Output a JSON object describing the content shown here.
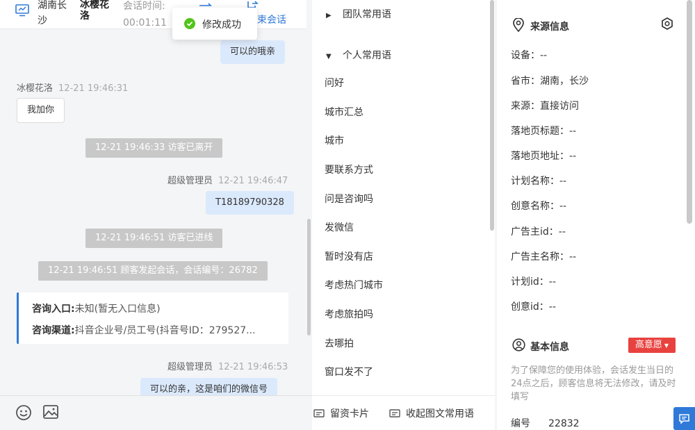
{
  "header": {
    "location": "湖南长沙",
    "visitor_name": "冰樱花洛",
    "session_time_label": "会话时间:",
    "session_time": "00:01:11",
    "end_session": "结束会话",
    "end_session_visible": "束会话"
  },
  "toast": {
    "text": "修改成功"
  },
  "messages": [
    {
      "type": "agent_text",
      "text": "可以的哦亲"
    },
    {
      "type": "visitor_meta",
      "name": "冰樱花洛",
      "time": "12-21 19:46:31"
    },
    {
      "type": "visitor_text",
      "text": "我加你"
    },
    {
      "type": "system",
      "text": "12-21 19:46:33 访客已离开"
    },
    {
      "type": "agent_meta",
      "name": "超级管理员",
      "time": "12-21 19:46:47"
    },
    {
      "type": "agent_text",
      "text": "T18189790328"
    },
    {
      "type": "system",
      "text": "12-21 19:46:51 访客已进线"
    },
    {
      "type": "system",
      "text": "12-21 19:46:51 顾客发起会话，会话编号：26782"
    },
    {
      "type": "agent_meta",
      "name": "超级管理员",
      "time": "12-21 19:46:53"
    },
    {
      "type": "agent_text",
      "text": "可以的亲，这是咱们的微信号"
    }
  ],
  "consult_card": {
    "entry_label": "咨询入口:",
    "entry_value": "未知(暂无入口信息)",
    "channel_label": "咨询渠道:",
    "channel_value": "抖音企业号/员工号(抖音号ID：279527..."
  },
  "phrases": {
    "team_group": "团队常用语",
    "personal_group": "个人常用语",
    "items": [
      "问好",
      "城市汇总",
      "城市",
      "要联系方式",
      "问是咨询吗",
      "发微信",
      "暂时没有店",
      "考虑热门城市",
      "考虑旅拍吗",
      "去哪拍",
      "窗口发不了"
    ],
    "card_button": "留资卡片",
    "collapse_button": "收起图文常用语"
  },
  "source_info": {
    "title": "来源信息",
    "fields": [
      "设备：--",
      "省市：湖南，长沙",
      "来源：直接访问",
      "落地页标题：--",
      "落地页地址：--",
      "计划名称：--",
      "创意名称：--",
      "广告主id：--",
      "广告主名称：--",
      "计划id：--",
      "创意id：--"
    ]
  },
  "basic_info": {
    "title": "基本信息",
    "intent_badge": "高意愿",
    "notice": "为了保障您的使用体验，会话发生当日的24点之后，顾客信息将无法修改，请及时填写",
    "id_label": "编号",
    "id_value": "22832"
  },
  "colors": {
    "accent": "#2f7ad9",
    "agent_bubble": "#dbe9fc",
    "badge": "#e8423f",
    "success": "#52c41a"
  }
}
